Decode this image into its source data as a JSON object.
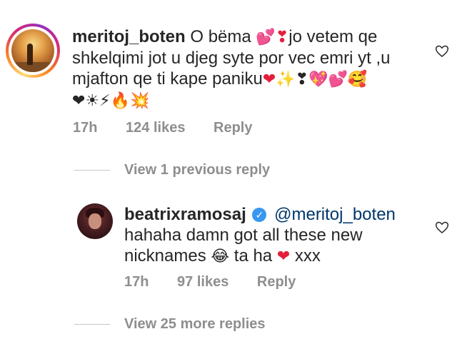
{
  "comment": {
    "username": "meritoj_boten",
    "text_part1": "O bëma ",
    "emoji_1": "💕",
    "emoji_2": "❣",
    "text_part2": "jo vetem qe shkelqimi jot u djeg syte por vec emri yt ,u mjafton qe ti kape paniku",
    "emoji_3": "❤",
    "emoji_line_a": "✨❣💖💕🥰",
    "emoji_line_b": "❤☀⚡🔥💥",
    "time": "17h",
    "likes": "124 likes",
    "reply_label": "Reply"
  },
  "view_previous": "View 1 previous reply",
  "reply": {
    "username": "beatrixramosaj",
    "verified_glyph": "✓",
    "mention": "@meritoj_boten",
    "text_part1": "hahaha damn got all these new nicknames ",
    "emoji_1": "😂",
    "text_part2": " ta ha ",
    "emoji_2": "❤",
    "text_part3": " xxx",
    "time": "17h",
    "likes": "97 likes",
    "reply_label": "Reply"
  },
  "view_more": "View 25 more replies",
  "colors": {
    "text": "#262626",
    "secondary": "#8e8e8e",
    "mention": "#00376b",
    "verified": "#3897f0",
    "heart": "#e3203b"
  },
  "icons": [
    "like-heart-icon",
    "verified-badge-icon"
  ]
}
